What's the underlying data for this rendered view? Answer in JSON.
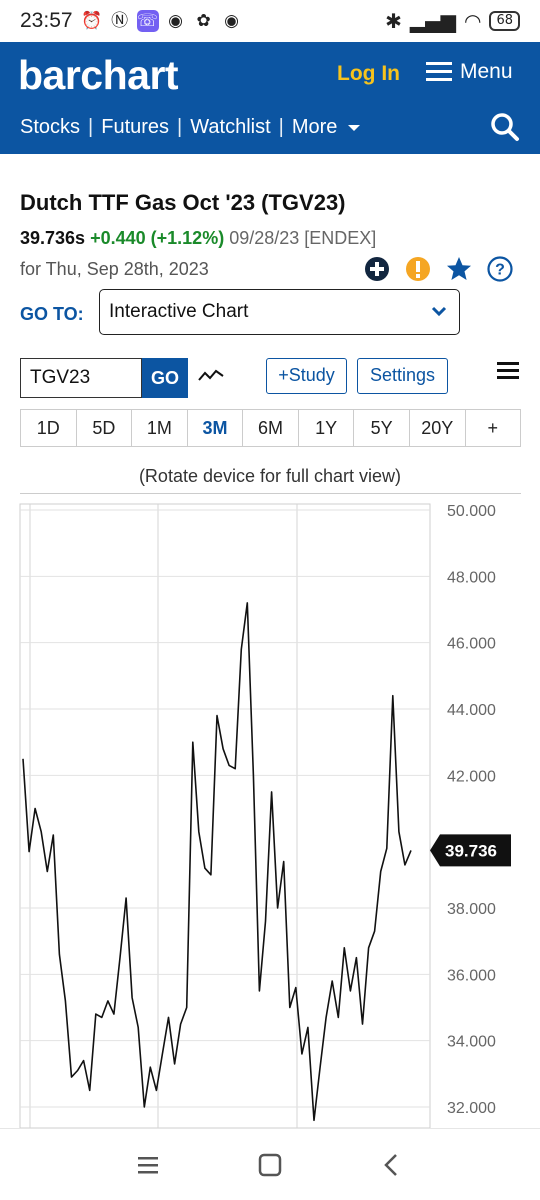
{
  "status_bar": {
    "time": "23:57",
    "battery": "68",
    "left_icons": [
      "alarm-icon",
      "nfc-icon",
      "viber-icon",
      "chrome-icon",
      "app-icon",
      "chrome-icon"
    ],
    "right_icons": [
      "bluetooth-icon",
      "signal-icon",
      "wifi-icon",
      "battery-icon"
    ]
  },
  "header": {
    "logo": "barchart",
    "login": "Log In",
    "menu": "Menu",
    "nav": [
      "Stocks",
      "Futures",
      "Watchlist",
      "More"
    ],
    "brand_color": "#0c55a2",
    "accent_color": "#f7c31c"
  },
  "quote": {
    "title": "Dutch TTF Gas Oct '23 (TGV23)",
    "last": "39.736s",
    "change": "+0.440 (+1.12%)",
    "meta": "09/28/23 [ENDEX]",
    "date": "for Thu, Sep 28th, 2023",
    "change_color": "#1a8a2a"
  },
  "goto": {
    "label": "GO TO:",
    "selected": "Interactive Chart"
  },
  "toolbar": {
    "symbol": "TGV23",
    "go": "GO",
    "study": "+Study",
    "settings": "Settings"
  },
  "periods": [
    "1D",
    "5D",
    "1M",
    "3M",
    "6M",
    "1Y",
    "5Y",
    "20Y",
    "+"
  ],
  "active_period": "3M",
  "rotate_note": "(Rotate device for full chart view)",
  "chart_data": {
    "type": "line",
    "ylim": [
      31.5,
      50.2
    ],
    "y_ticks": [
      "50.000",
      "48.000",
      "46.000",
      "44.000",
      "42.000",
      "38.000",
      "36.000",
      "34.000",
      "32.000"
    ],
    "last_value_label": "39.736",
    "values": [
      42.5,
      39.7,
      41.0,
      40.3,
      39.1,
      40.2,
      36.6,
      35.2,
      32.9,
      33.1,
      33.4,
      32.5,
      34.8,
      34.7,
      35.2,
      34.8,
      36.5,
      38.3,
      35.3,
      34.4,
      32.0,
      33.2,
      32.5,
      33.6,
      34.7,
      33.3,
      34.5,
      35.0,
      43.0,
      40.3,
      39.2,
      39.0,
      43.8,
      42.8,
      42.3,
      42.2,
      45.8,
      47.2,
      42.0,
      35.5,
      37.6,
      41.5,
      38.0,
      39.4,
      35.0,
      35.6,
      33.6,
      34.4,
      31.6,
      33.2,
      34.7,
      35.8,
      34.7,
      36.8,
      35.5,
      36.5,
      34.5,
      36.8,
      37.3,
      39.1,
      39.8,
      44.4,
      40.3,
      39.3,
      39.736
    ]
  }
}
